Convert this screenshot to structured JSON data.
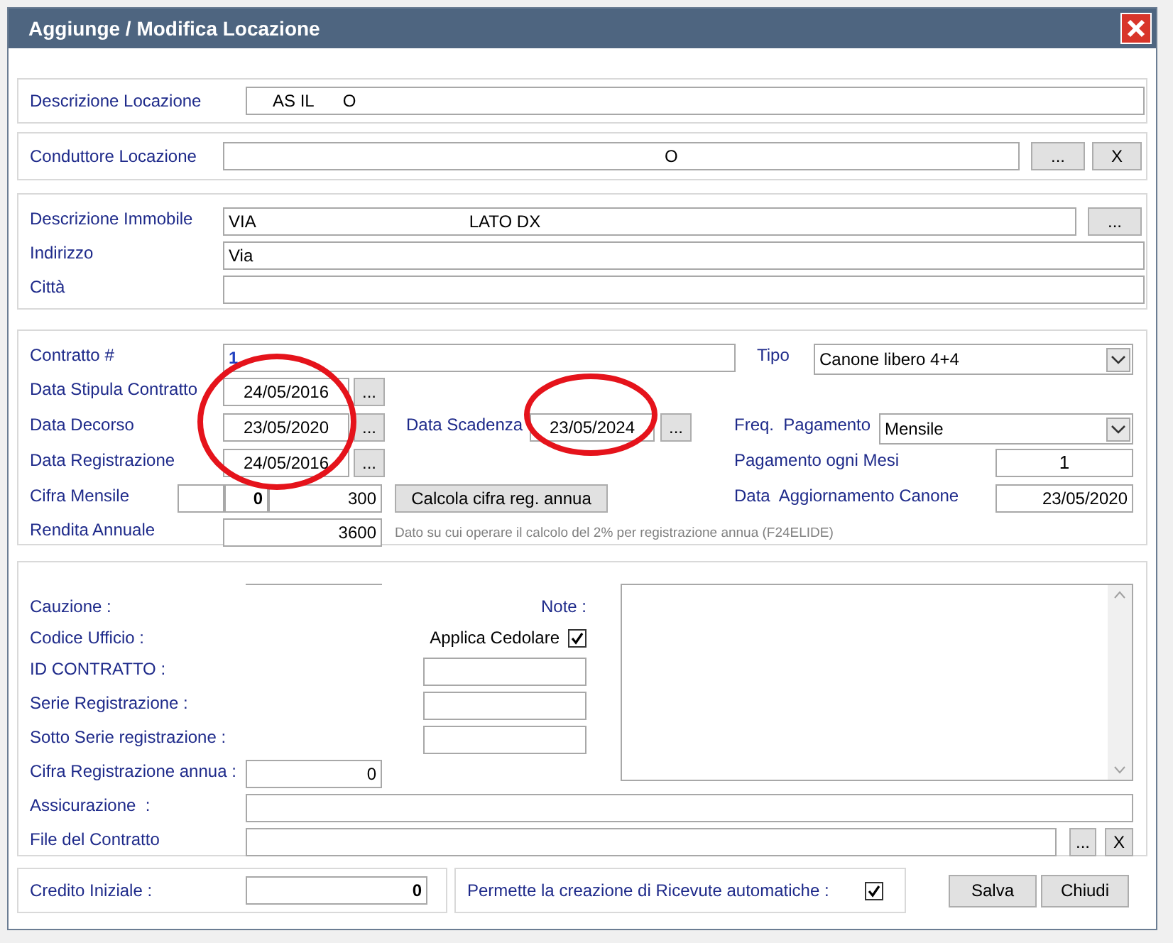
{
  "window": {
    "title": "Aggiunge / Modifica Locazione"
  },
  "location": {
    "label": "Descrizione Locazione",
    "value_parts": [
      "AS IL",
      "O"
    ]
  },
  "tenant": {
    "label": "Conduttore Locazione",
    "value_parts": [
      "O"
    ],
    "buttons": [
      "...",
      "X"
    ]
  },
  "property": [
    {
      "label": "Descrizione Immobile",
      "value_parts": [
        "VIA",
        "LATO DX"
      ],
      "button": "..."
    },
    {
      "label": "Indirizzo",
      "value_parts": [
        "Via"
      ]
    },
    {
      "label": "Città"
    }
  ],
  "contract": {
    "number": {
      "label": "Contratto #",
      "value": "1"
    },
    "type": {
      "label": "Tipo",
      "value": "Canone libero 4+4"
    },
    "stipula": {
      "label": "Data Stipula Contratto",
      "value": "24/05/2016",
      "button": "..."
    },
    "decorso": {
      "label": "Data Decorso",
      "value": "23/05/2020",
      "button": "..."
    },
    "scadenza": {
      "label": "Data Scadenza",
      "value": "23/05/2024",
      "button": "..."
    },
    "frequency": {
      "label": "Freq.  Pagamento",
      "value": "Mensile"
    },
    "registrazione": {
      "label": "Data Registrazione",
      "value": "24/05/2016",
      "button": "..."
    },
    "months": {
      "label": "Pagamento ogni Mesi",
      "value": "1"
    },
    "monthly": {
      "label": "Cifra Mensile",
      "values": [
        "0",
        "300"
      ]
    },
    "calc_button": "Calcola cifra reg. annua",
    "update": {
      "label": "Data  Aggiornamento Canone",
      "value": "23/05/2020"
    },
    "annual": {
      "label": "Rendita Annuale",
      "value": "3600",
      "hint": "Dato su cui operare il calcolo del 2% per registrazione annua (F24ELIDE)"
    }
  },
  "details": {
    "cauzione": "Cauzione :",
    "note": "Note :",
    "codice": "Codice Ufficio :",
    "cedolare": {
      "label": "Applica Cedolare",
      "checked": true
    },
    "id_contratto": "ID CONTRATTO :",
    "serie": "Serie Registrazione :",
    "sotto_serie": "Sotto Serie registrazione :",
    "cifra": {
      "label": "Cifra  Registrazione annua :",
      "value": "0"
    },
    "assicurazione": "Assicurazione  :",
    "file": {
      "label": "File del Contratto",
      "buttons": [
        "...",
        "X"
      ]
    }
  },
  "footer": {
    "credit": {
      "label": "Credito Iniziale :",
      "value": "0"
    },
    "receipts": {
      "label": "Permette la creazione di Ricevute automatiche :",
      "checked": true
    },
    "buttons": [
      "Salva",
      "Chiudi"
    ]
  },
  "annotations": [
    {
      "kind": "ellipse"
    },
    {
      "kind": "ellipse"
    }
  ]
}
